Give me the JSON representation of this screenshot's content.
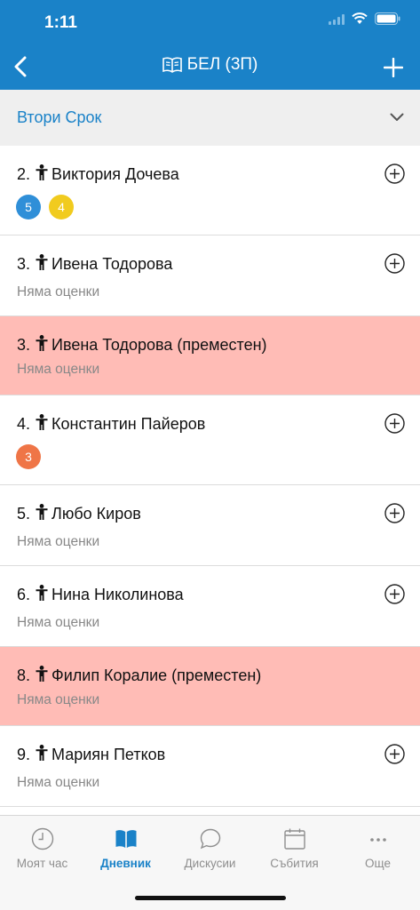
{
  "status": {
    "time": "1:11"
  },
  "nav": {
    "title": "БЕЛ (3П)"
  },
  "term": {
    "label": "Втори Срок"
  },
  "colors": {
    "accent": "#1a82c8",
    "moved_bg": "#ffbcb6",
    "grade_5": "#2f8fd8",
    "grade_4": "#f1cb1e",
    "grade_3": "#ef7547"
  },
  "students": [
    {
      "num": "2.",
      "name": "Виктория Дочева",
      "moved": false,
      "grades": [
        {
          "value": "5",
          "color": "#2f8fd8"
        },
        {
          "value": "4",
          "color": "#f1cb1e"
        }
      ],
      "no_grades": ""
    },
    {
      "num": "3.",
      "name": "Ивена Тодорова",
      "moved": false,
      "grades": [],
      "no_grades": "Няма оценки"
    },
    {
      "num": "3.",
      "name": "Ивена Тодорова (преместен)",
      "moved": true,
      "grades": [],
      "no_grades": "Няма оценки"
    },
    {
      "num": "4.",
      "name": "Константин Пайеров",
      "moved": false,
      "grades": [
        {
          "value": "3",
          "color": "#ef7547"
        }
      ],
      "no_grades": ""
    },
    {
      "num": "5.",
      "name": "Любо Киров",
      "moved": false,
      "grades": [],
      "no_grades": "Няма оценки"
    },
    {
      "num": "6.",
      "name": "Нина Николинова",
      "moved": false,
      "grades": [],
      "no_grades": "Няма оценки"
    },
    {
      "num": "8.",
      "name": "Филип Коралие (преместен)",
      "moved": true,
      "grades": [],
      "no_grades": "Няма оценки"
    },
    {
      "num": "9.",
      "name": "Мариян Петков",
      "moved": false,
      "grades": [],
      "no_grades": "Няма оценки"
    }
  ],
  "tabs": [
    {
      "label": "Моят час",
      "icon": "clock-icon",
      "active": false
    },
    {
      "label": "Дневник",
      "icon": "book-icon",
      "active": true
    },
    {
      "label": "Дискусии",
      "icon": "chat-bubble-icon",
      "active": false
    },
    {
      "label": "Събития",
      "icon": "calendar-icon",
      "active": false
    },
    {
      "label": "Още",
      "icon": "more-dots-icon",
      "active": false
    }
  ]
}
